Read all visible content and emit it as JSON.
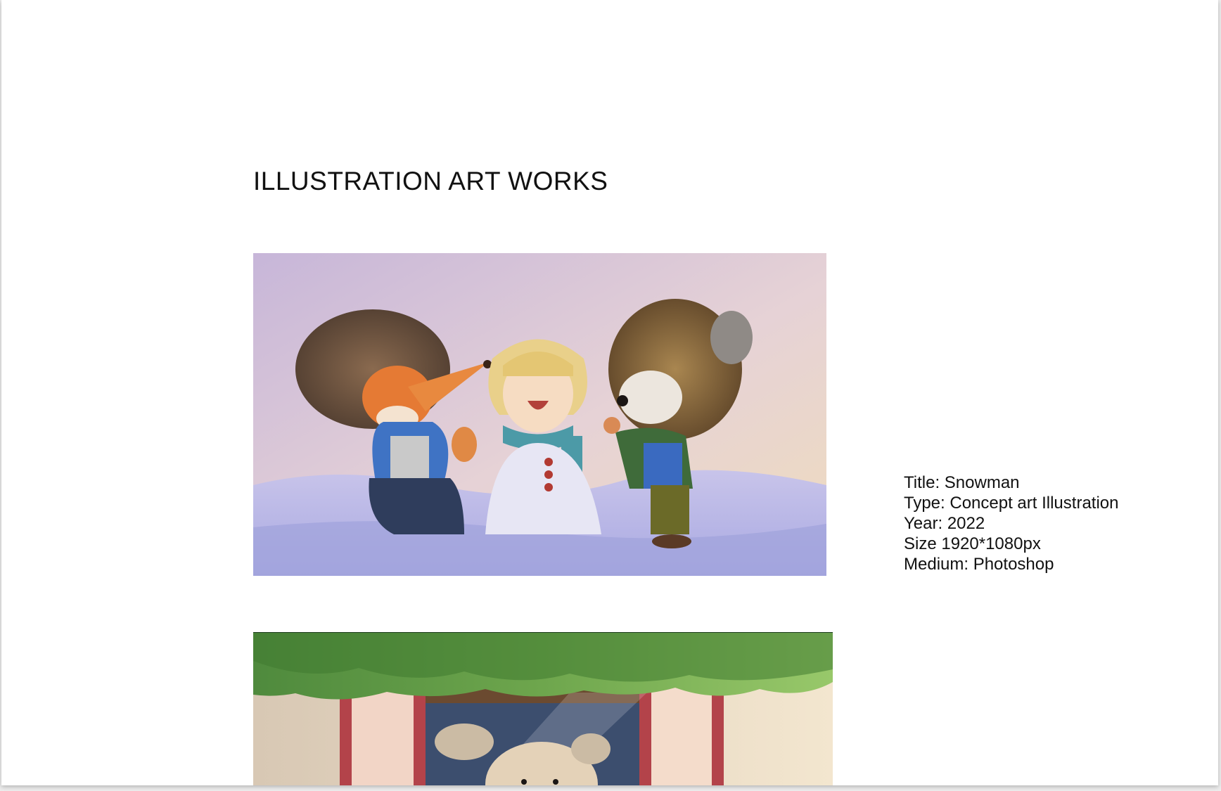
{
  "page": {
    "heading": "ILLUSTRATION ART WORKS"
  },
  "artworks": [
    {
      "details": {
        "title": "Title: Snowman",
        "type": "Type: Concept art Illustration",
        "year": "Year: 2022",
        "size": "Size 1920*1080px",
        "medium": "Medium: Photoshop"
      }
    }
  ],
  "colors": {
    "background": "#ffffff",
    "text": "#111111",
    "frame": "#ededed"
  }
}
